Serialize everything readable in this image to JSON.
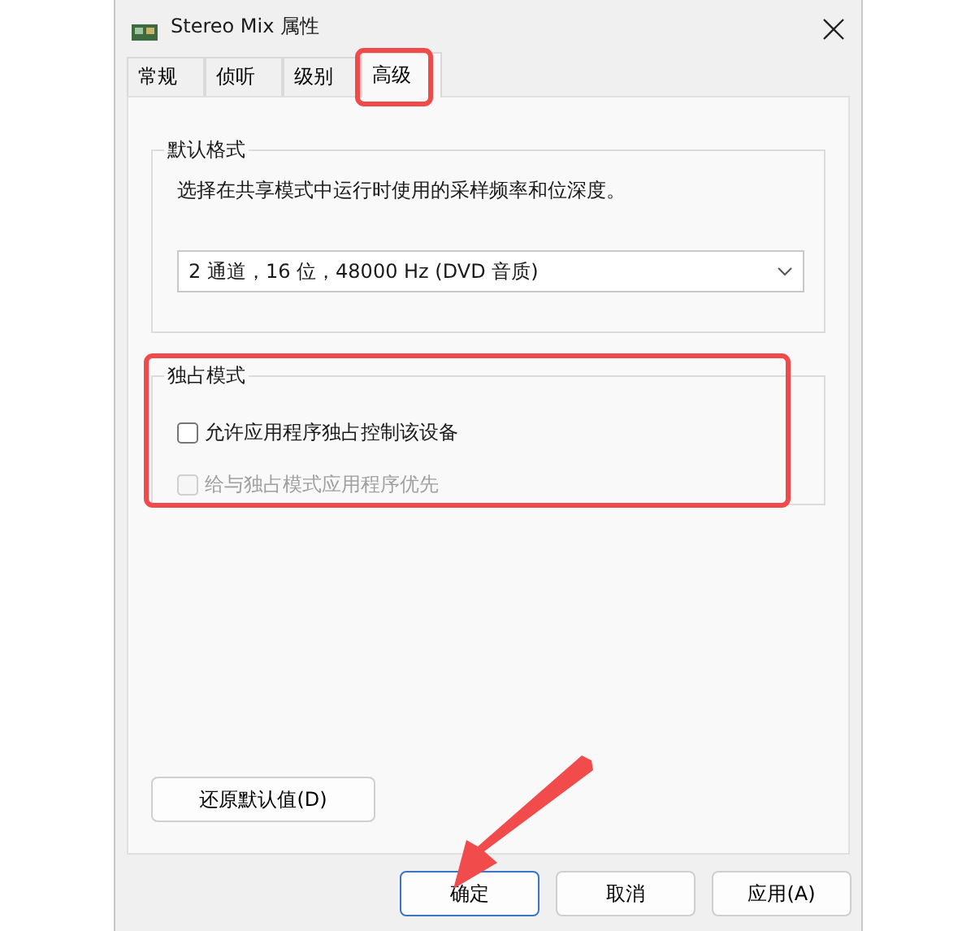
{
  "window": {
    "title": "Stereo Mix 属性"
  },
  "tabs": [
    {
      "label": "常规",
      "selected": false
    },
    {
      "label": "侦听",
      "selected": false
    },
    {
      "label": "级别",
      "selected": false
    },
    {
      "label": "高级",
      "selected": true
    }
  ],
  "default_format": {
    "legend": "默认格式",
    "description": "选择在共享模式中运行时使用的采样频率和位深度。",
    "dropdown_value": "2 通道，16 位，48000 Hz (DVD 音质)"
  },
  "exclusive_mode": {
    "legend": "独占模式",
    "options": [
      {
        "label": "允许应用程序独占控制该设备",
        "checked": false,
        "disabled": false
      },
      {
        "label": "给与独占模式应用程序优先",
        "checked": false,
        "disabled": true
      }
    ]
  },
  "restore_button": "还原默认值(D)",
  "buttons": [
    {
      "label": "确定",
      "default": true
    },
    {
      "label": "取消",
      "default": false
    },
    {
      "label": "应用(A)",
      "default": false
    }
  ]
}
